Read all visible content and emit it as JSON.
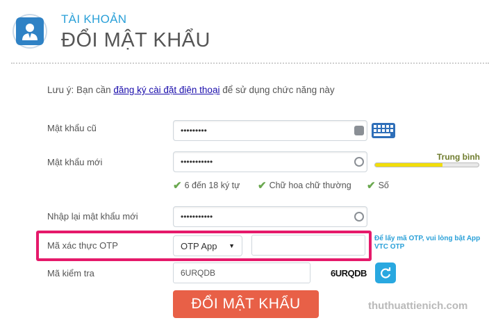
{
  "header": {
    "section_label": "TÀI KHOẢN",
    "title": "ĐỔI MẬT KHẨU",
    "avatar_icon": "user-avatar-icon"
  },
  "note": {
    "prefix": "Lưu ý: Bạn cần ",
    "link_text": "đăng ký cài đặt điện thoại",
    "suffix": " để sử dụng chức năng này"
  },
  "form": {
    "old_password": {
      "label": "Mật khẩu cũ",
      "value": "•••••••••"
    },
    "new_password": {
      "label": "Mật khẩu mới",
      "value": "•••••••••••"
    },
    "strength": {
      "label": "Trung bình",
      "level": 0.65,
      "color": "#f2de0a"
    },
    "rules": [
      {
        "text": "6 đến 18 ký tự"
      },
      {
        "text": "Chữ hoa chữ thường"
      },
      {
        "text": "Số"
      }
    ],
    "confirm_password": {
      "label": "Nhập lại mật khẩu mới",
      "value": "•••••••••••"
    },
    "otp": {
      "label": "Mã xác thực OTP",
      "selected": "OTP App",
      "value": "",
      "hint": "Để lấy mã OTP, vui lòng bật App VTC OTP"
    },
    "captcha": {
      "label": "Mã kiểm tra",
      "value": "6URQDB",
      "image_text": "6URQDB"
    },
    "submit_label": "ĐỔI MẬT KHẨU"
  },
  "watermark": "thuthuattienich.com",
  "colors": {
    "accent": "#2aa0d8",
    "submit": "#e86047",
    "highlight": "#e5196a"
  }
}
